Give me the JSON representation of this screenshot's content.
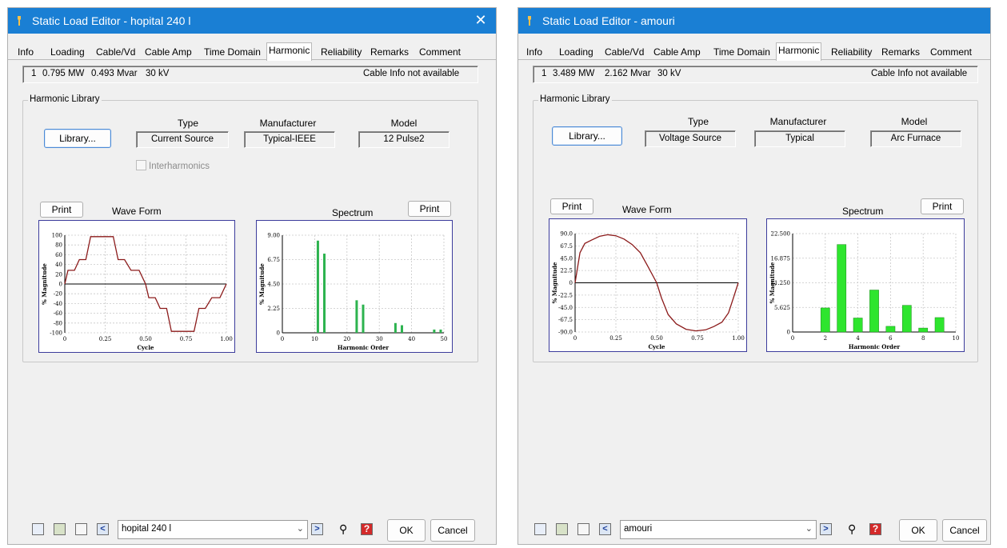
{
  "left": {
    "title": "Static Load Editor - hopital 240 l",
    "tabs": [
      "Info",
      "Loading",
      "Cable/Vd",
      "Cable Amp",
      "Time Domain",
      "Harmonic",
      "Reliability",
      "Remarks",
      "Comment"
    ],
    "active_tab": "Harmonic",
    "info_line": {
      "index": "1",
      "mw": "0.795 MW",
      "mvar": "0.493 Mvar",
      "kv": "30 kV",
      "cable": "Cable Info not available"
    },
    "group_title": "Harmonic Library",
    "library_button": "Library...",
    "col_type": "Type",
    "col_manufacturer": "Manufacturer",
    "col_model": "Model",
    "type_value": "Current Source",
    "manufacturer_value": "Typical-IEEE",
    "model_value": "12 Pulse2",
    "interharmonics_label": "Interharmonics",
    "print_label": "Print",
    "waveform_title": "Wave Form",
    "spectrum_title": "Spectrum",
    "load_name": "hopital 240 l",
    "ok_label": "OK",
    "cancel_label": "Cancel"
  },
  "right": {
    "title": "Static Load Editor - amouri",
    "tabs": [
      "Info",
      "Loading",
      "Cable/Vd",
      "Cable Amp",
      "Time Domain",
      "Harmonic",
      "Reliability",
      "Remarks",
      "Comment"
    ],
    "active_tab": "Harmonic",
    "info_line": {
      "index": "1",
      "mw": "3.489 MW",
      "mvar": "2.162 Mvar",
      "kv": "30 kV",
      "cable": "Cable Info not available"
    },
    "group_title": "Harmonic Library",
    "library_button": "Library...",
    "col_type": "Type",
    "col_manufacturer": "Manufacturer",
    "col_model": "Model",
    "type_value": "Voltage Source",
    "manufacturer_value": "Typical",
    "model_value": "Arc Furnace",
    "print_label": "Print",
    "waveform_title": "Wave Form",
    "spectrum_title": "Spectrum",
    "load_name": "amouri",
    "ok_label": "OK",
    "cancel_label": "Cancel"
  },
  "colors": {
    "titlebar": "#1a7fd4",
    "waveform_line": "#8b1a1a",
    "left_bars": "#2db34f",
    "right_bars": "#2ee52e",
    "plot_border": "#3c3c9c"
  },
  "chart_data": [
    {
      "id": "left-waveform",
      "type": "line",
      "xlabel": "Cycle",
      "ylabel": "% Magnitude",
      "xlim": [
        0,
        1.0
      ],
      "ylim": [
        -100,
        100
      ],
      "xticks": [
        "0",
        "0.25",
        "0.50",
        "0.75",
        "1.00"
      ],
      "yticks": [
        "100",
        "80",
        "60",
        "40",
        "20",
        "0",
        "-20",
        "-40",
        "-60",
        "-80",
        "-100"
      ],
      "x": [
        0,
        0.02,
        0.06,
        0.09,
        0.13,
        0.16,
        0.2,
        0.26,
        0.3,
        0.33,
        0.37,
        0.41,
        0.46,
        0.5,
        0.52,
        0.56,
        0.59,
        0.63,
        0.66,
        0.7,
        0.76,
        0.8,
        0.83,
        0.87,
        0.91,
        0.96,
        1.0
      ],
      "y": [
        0,
        28,
        28,
        50,
        50,
        97,
        97,
        97,
        97,
        50,
        50,
        28,
        28,
        0,
        -28,
        -28,
        -50,
        -50,
        -97,
        -97,
        -97,
        -97,
        -50,
        -50,
        -28,
        -28,
        0
      ]
    },
    {
      "id": "left-spectrum",
      "type": "bar",
      "xlabel": "Harmonic Order",
      "ylabel": "% Magnitude",
      "xlim": [
        0,
        50
      ],
      "ylim": [
        0,
        9.0
      ],
      "xticks": [
        "0",
        "10",
        "20",
        "30",
        "40",
        "50"
      ],
      "yticks": [
        "9.00",
        "6.75",
        "4.50",
        "2.25",
        "0"
      ],
      "categories": [
        11,
        13,
        23,
        25,
        35,
        37,
        47,
        49
      ],
      "values": [
        8.5,
        7.3,
        3.0,
        2.6,
        0.9,
        0.7,
        0.3,
        0.3
      ]
    },
    {
      "id": "right-waveform",
      "type": "line",
      "xlabel": "Cycle",
      "ylabel": "% Magnitude",
      "xlim": [
        0,
        1.0
      ],
      "ylim": [
        -90,
        90
      ],
      "xticks": [
        "0",
        "0.25",
        "0.50",
        "0.75",
        "1.00"
      ],
      "yticks": [
        "90.0",
        "67.5",
        "45.0",
        "22.5",
        "0",
        "-22.5",
        "-45.0",
        "-67.5",
        "-90.0"
      ],
      "x": [
        0,
        0.03,
        0.06,
        0.1,
        0.15,
        0.2,
        0.25,
        0.3,
        0.35,
        0.4,
        0.45,
        0.5,
        0.53,
        0.57,
        0.62,
        0.68,
        0.74,
        0.8,
        0.85,
        0.9,
        0.94,
        0.97,
        1.0
      ],
      "y": [
        0,
        55,
        72,
        78,
        85,
        88,
        86,
        80,
        70,
        55,
        28,
        0,
        -28,
        -58,
        -75,
        -85,
        -88,
        -86,
        -80,
        -72,
        -55,
        -28,
        0
      ]
    },
    {
      "id": "right-spectrum",
      "type": "bar",
      "xlabel": "Harmonic Order",
      "ylabel": "% Magnitude",
      "xlim": [
        0,
        10
      ],
      "ylim": [
        0,
        22.5
      ],
      "xticks": [
        "0",
        "2",
        "4",
        "6",
        "8",
        "10"
      ],
      "yticks": [
        "22.500",
        "16.875",
        "11.250",
        "5.625",
        "0"
      ],
      "categories": [
        2,
        3,
        4,
        5,
        6,
        7,
        8,
        9
      ],
      "values": [
        5.5,
        20.0,
        3.2,
        9.6,
        1.3,
        6.1,
        0.9,
        3.3
      ]
    }
  ]
}
